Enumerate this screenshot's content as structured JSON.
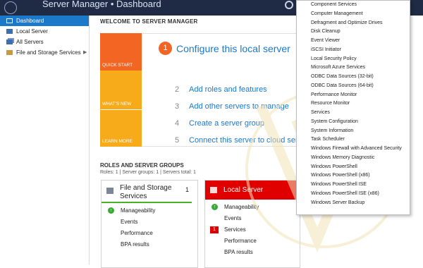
{
  "titlebar": {
    "title": "Server Manager • Dashboard"
  },
  "sidebar": {
    "items": [
      {
        "label": "Dashboard",
        "icon": "dashboard-icon"
      },
      {
        "label": "Local Server",
        "icon": "server-icon"
      },
      {
        "label": "All Servers",
        "icon": "servers-icon"
      },
      {
        "label": "File and Storage Services",
        "icon": "files-icon"
      }
    ]
  },
  "welcome": {
    "header": "WELCOME TO SERVER MANAGER",
    "tiles": {
      "quick_start": "QUICK START",
      "whats_new": "WHAT'S NEW",
      "learn_more": "LEARN MORE"
    },
    "steps": [
      {
        "num": "1",
        "label": "Configure this local server"
      },
      {
        "num": "2",
        "label": "Add roles and features"
      },
      {
        "num": "3",
        "label": "Add other servers to manage"
      },
      {
        "num": "4",
        "label": "Create a server group"
      },
      {
        "num": "5",
        "label": "Connect this server to cloud services"
      }
    ]
  },
  "groups": {
    "header": "ROLES AND SERVER GROUPS",
    "summary": "Roles: 1   |   Server groups: 1   |   Servers total: 1",
    "cards": [
      {
        "title_line1": "File and Storage",
        "title_line2": "Services",
        "count": "1",
        "rows": [
          "Manageability",
          "Events",
          "Performance",
          "BPA results"
        ]
      },
      {
        "title": "Local Server",
        "count": "1",
        "services_badge": "1",
        "rows": [
          "Manageability",
          "Events",
          "Services",
          "Performance",
          "BPA results"
        ]
      }
    ]
  },
  "tools_menu": {
    "items": [
      "Component Services",
      "Computer Management",
      "Defragment and Optimize Drives",
      "Disk Cleanup",
      "Event Viewer",
      "iSCSI Initiator",
      "Local Security Policy",
      "Microsoft Azure Services",
      "ODBC Data Sources (32-bit)",
      "ODBC Data Sources (64-bit)",
      "Performance Monitor",
      "Resource Monitor",
      "Services",
      "System Configuration",
      "System Information",
      "Task Scheduler",
      "Windows Firewall with Advanced Security",
      "Windows Memory Diagnostic",
      "Windows PowerShell",
      "Windows PowerShell (x86)",
      "Windows PowerShell ISE",
      "Windows PowerShell ISE (x86)",
      "Windows Server Backup"
    ]
  },
  "colors": {
    "accent": "#1c78c8",
    "quick_start": "#f26522",
    "tile": "#f7ab1b",
    "ok": "#39a935",
    "error": "#e00000",
    "titlebar": "#1f2a44"
  }
}
